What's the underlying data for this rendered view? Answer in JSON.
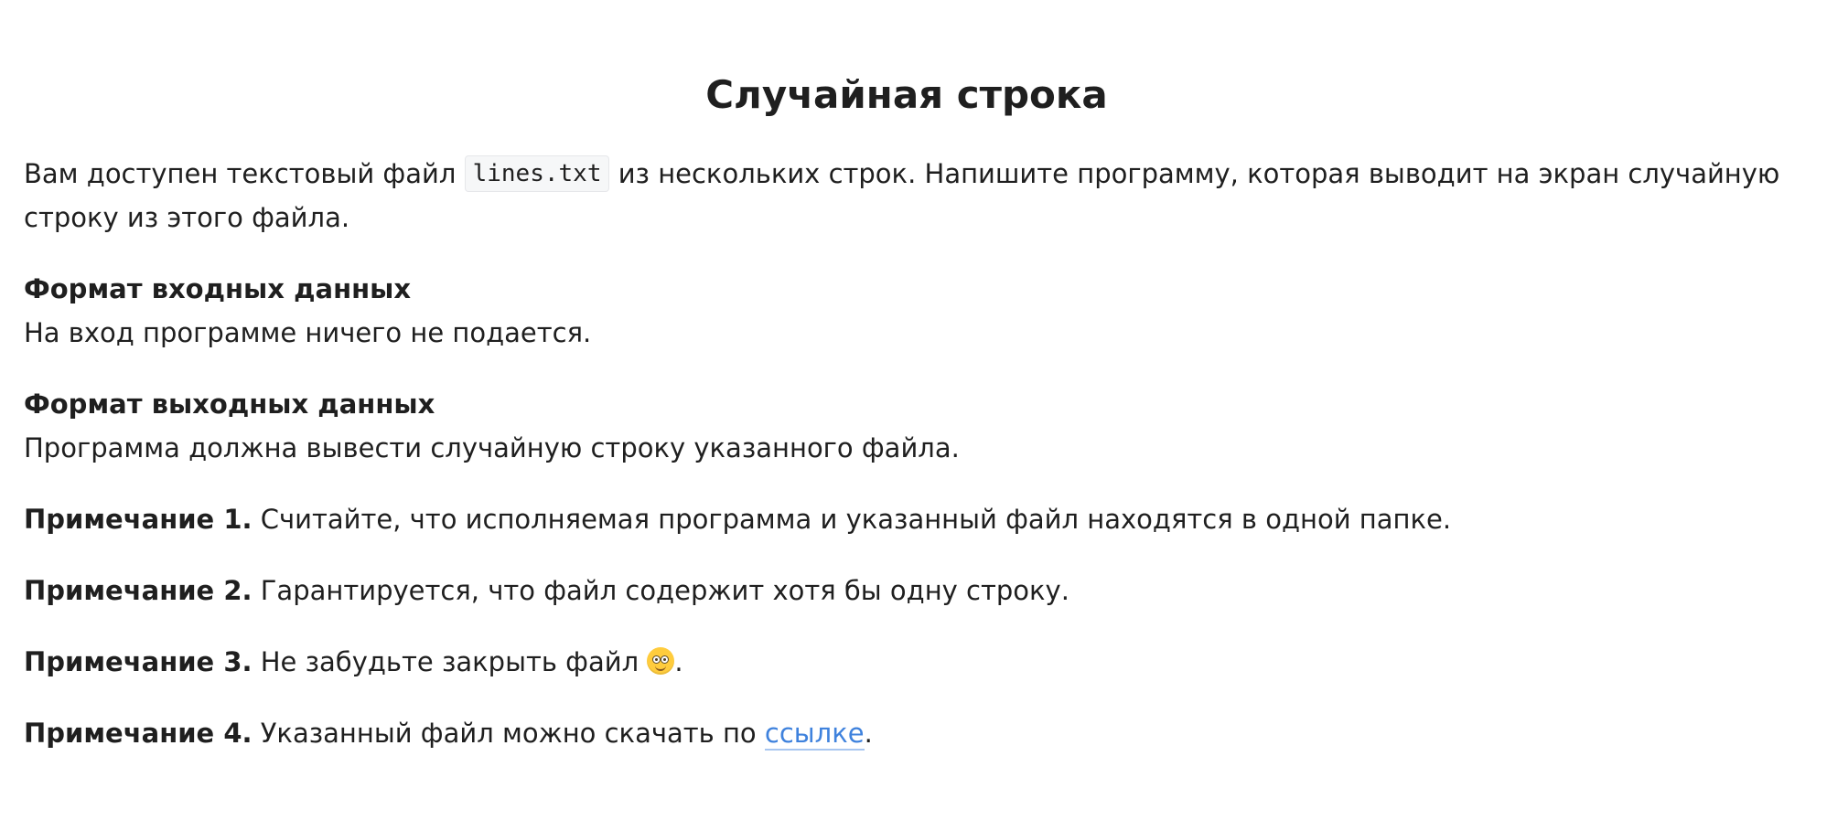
{
  "title": "Случайная строка",
  "intro": {
    "before": "Вам доступен текстовый файл",
    "code": "lines.txt",
    "after": "из нескольких строк. Напишите программу, которая выводит на экран случайную строку из этого файла."
  },
  "input_format": {
    "heading": "Формат входных данных",
    "text": "На вход программе ничего не подается."
  },
  "output_format": {
    "heading": "Формат выходных данных",
    "text": "Программа должна вывести случайную строку указанного файла."
  },
  "notes": [
    {
      "label": "Примечание 1.",
      "text": "Считайте, что исполняемая программа и указанный файл находятся в одной папке."
    },
    {
      "label": "Примечание 2.",
      "text": "Гарантируется, что файл содержит хотя бы одну строку."
    },
    {
      "label": "Примечание 3.",
      "text": "Не забудьте закрыть файл",
      "emoji": "winking-face-icon",
      "tail": "."
    },
    {
      "label": "Примечание 4.",
      "text": "Указанный файл можно скачать по",
      "link": "ссылке",
      "tail": "."
    }
  ],
  "colors": {
    "text": "#1f1f1f",
    "link": "#3f82dd",
    "code_bg": "#f6f7f8"
  }
}
